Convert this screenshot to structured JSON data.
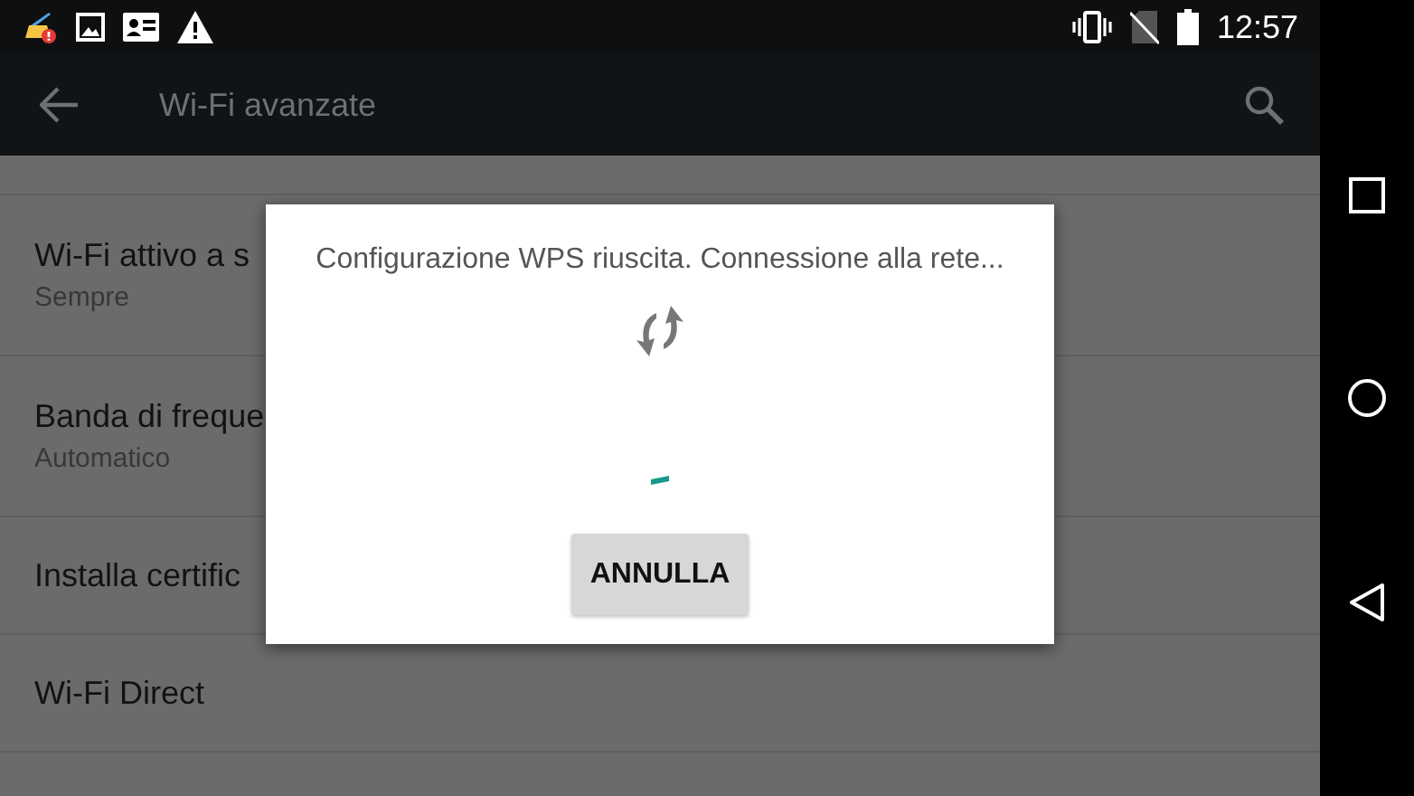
{
  "status_bar": {
    "time": "12:57"
  },
  "toolbar": {
    "title": "Wi-Fi avanzate"
  },
  "settings": [
    {
      "title": "Wi-Fi attivo a s",
      "subtitle": "Sempre"
    },
    {
      "title": "Banda di freque",
      "subtitle": "Automatico"
    },
    {
      "title": "Installa certific"
    },
    {
      "title": "Wi-Fi Direct"
    }
  ],
  "dialog": {
    "message": "Configurazione WPS riuscita. Connessione alla rete...",
    "button": "ANNULLA"
  }
}
